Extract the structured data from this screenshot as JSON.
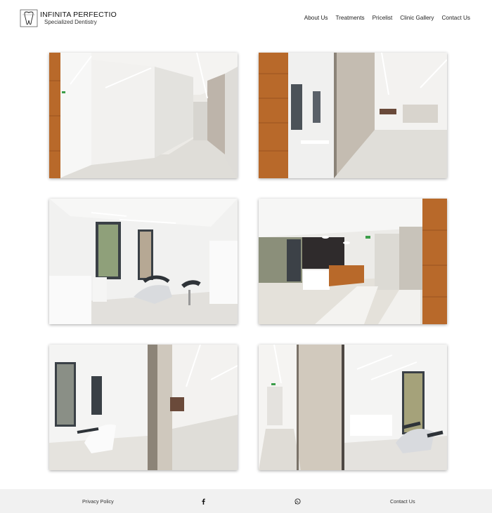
{
  "brand": {
    "name": "INFINITA PERFECTIO",
    "tagline": "Specialized Dentistry"
  },
  "nav": {
    "items": [
      "About Us",
      "Treatments",
      "Pricelist",
      "Clinic Gallery",
      "Contact Us"
    ]
  },
  "gallery": {
    "images": [
      "corridor-white-walls-wood-panel-icon",
      "glass-door-wood-panel-icon",
      "dental-treatment-room-icon",
      "reception-desk-icon",
      "treatment-room-through-door-icon",
      "corridor-to-treatment-room-icon"
    ]
  },
  "footer": {
    "privacy": "Privacy Policy",
    "contact": "Contact Us",
    "facebook_icon": "facebook-icon",
    "whatsapp_icon": "whatsapp-icon"
  },
  "colors": {
    "wood": "#b8692a",
    "wall": "#e9e8e4",
    "floor": "#dcdad4",
    "footer_bg": "#f1f1f1"
  }
}
